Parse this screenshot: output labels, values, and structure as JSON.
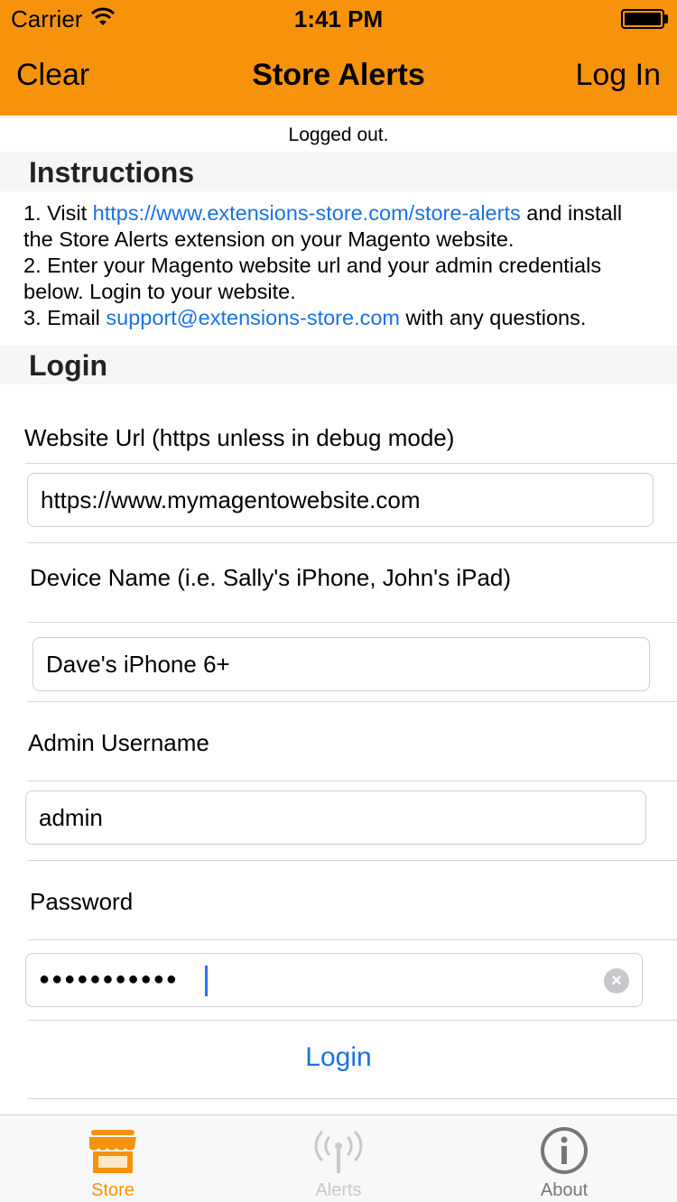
{
  "status_bar": {
    "carrier": "Carrier",
    "time": "1:41 PM"
  },
  "nav": {
    "left": "Clear",
    "title": "Store Alerts",
    "right": "Log In"
  },
  "login_status": "Logged out.",
  "sections": {
    "instructions": "Instructions",
    "login": "Login"
  },
  "instructions": {
    "l1_prefix": "1. Visit ",
    "l1_link": "https://www.extensions-store.com/store-alerts",
    "l1_suffix": " and install the Store Alerts extension on your Magento website.",
    "l2": "2. Enter your Magento website url and your admin credentials below. Login to your website.",
    "l3_prefix": "3. Email ",
    "l3_link": "support@extensions-store.com",
    "l3_suffix": " with any questions."
  },
  "form": {
    "website_label": "Website Url (https unless in debug mode)",
    "website_value": "https://www.mymagentowebsite.com",
    "device_label": "Device Name (i.e. Sally's iPhone, John's iPad)",
    "device_value": "Dave's iPhone 6+",
    "username_label": "Admin Username",
    "username_value": "admin",
    "password_label": "Password",
    "password_mask": "●●●●●●●●●●●",
    "login_button": "Login"
  },
  "tabs": [
    {
      "label": "Store",
      "icon": "store-icon",
      "state": "selected"
    },
    {
      "label": "Alerts",
      "icon": "antenna-icon",
      "state": "disabled"
    },
    {
      "label": "About",
      "icon": "info-icon",
      "state": "normal"
    }
  ],
  "colors": {
    "brand_orange": "#f7930a",
    "link_blue": "#1a73e0",
    "tab_selected": "#f7930a",
    "tab_disabled": "#c9c9c9",
    "tab_normal": "#777777"
  }
}
